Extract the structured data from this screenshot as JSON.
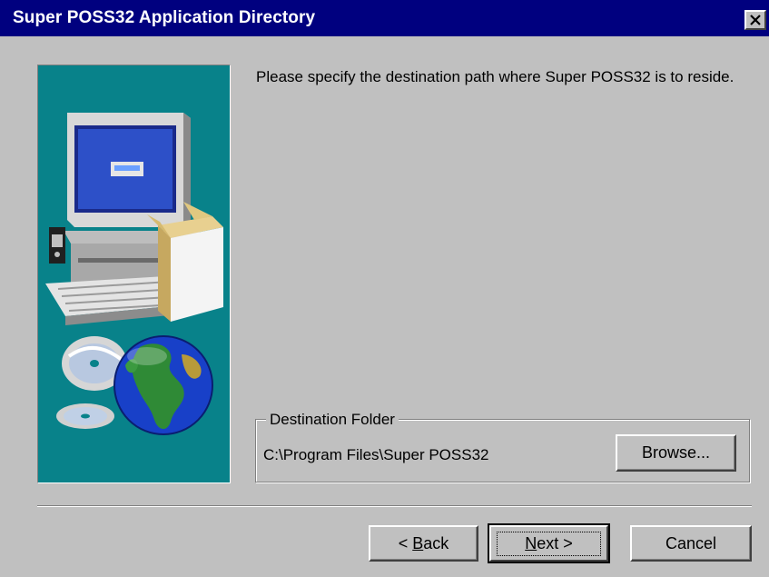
{
  "window": {
    "title": "Super POSS32 Application Directory",
    "close_symbol": "✕"
  },
  "banner": {
    "background": "#08828a",
    "illustration": "computer-box-cd-globe"
  },
  "instruction": "Please specify the destination path where Super POSS32 is to reside.",
  "destination": {
    "legend": "Destination Folder",
    "path": "C:\\Program Files\\Super POSS32",
    "browse_label": "Browse..."
  },
  "buttons": {
    "back_prefix": "< ",
    "back_accel": "B",
    "back_rest": "ack",
    "next_accel": "N",
    "next_rest": "ext >",
    "cancel_label": "Cancel"
  },
  "colors": {
    "titlebar": "#00007f",
    "face": "#c0c0c0",
    "banner": "#08828a"
  }
}
